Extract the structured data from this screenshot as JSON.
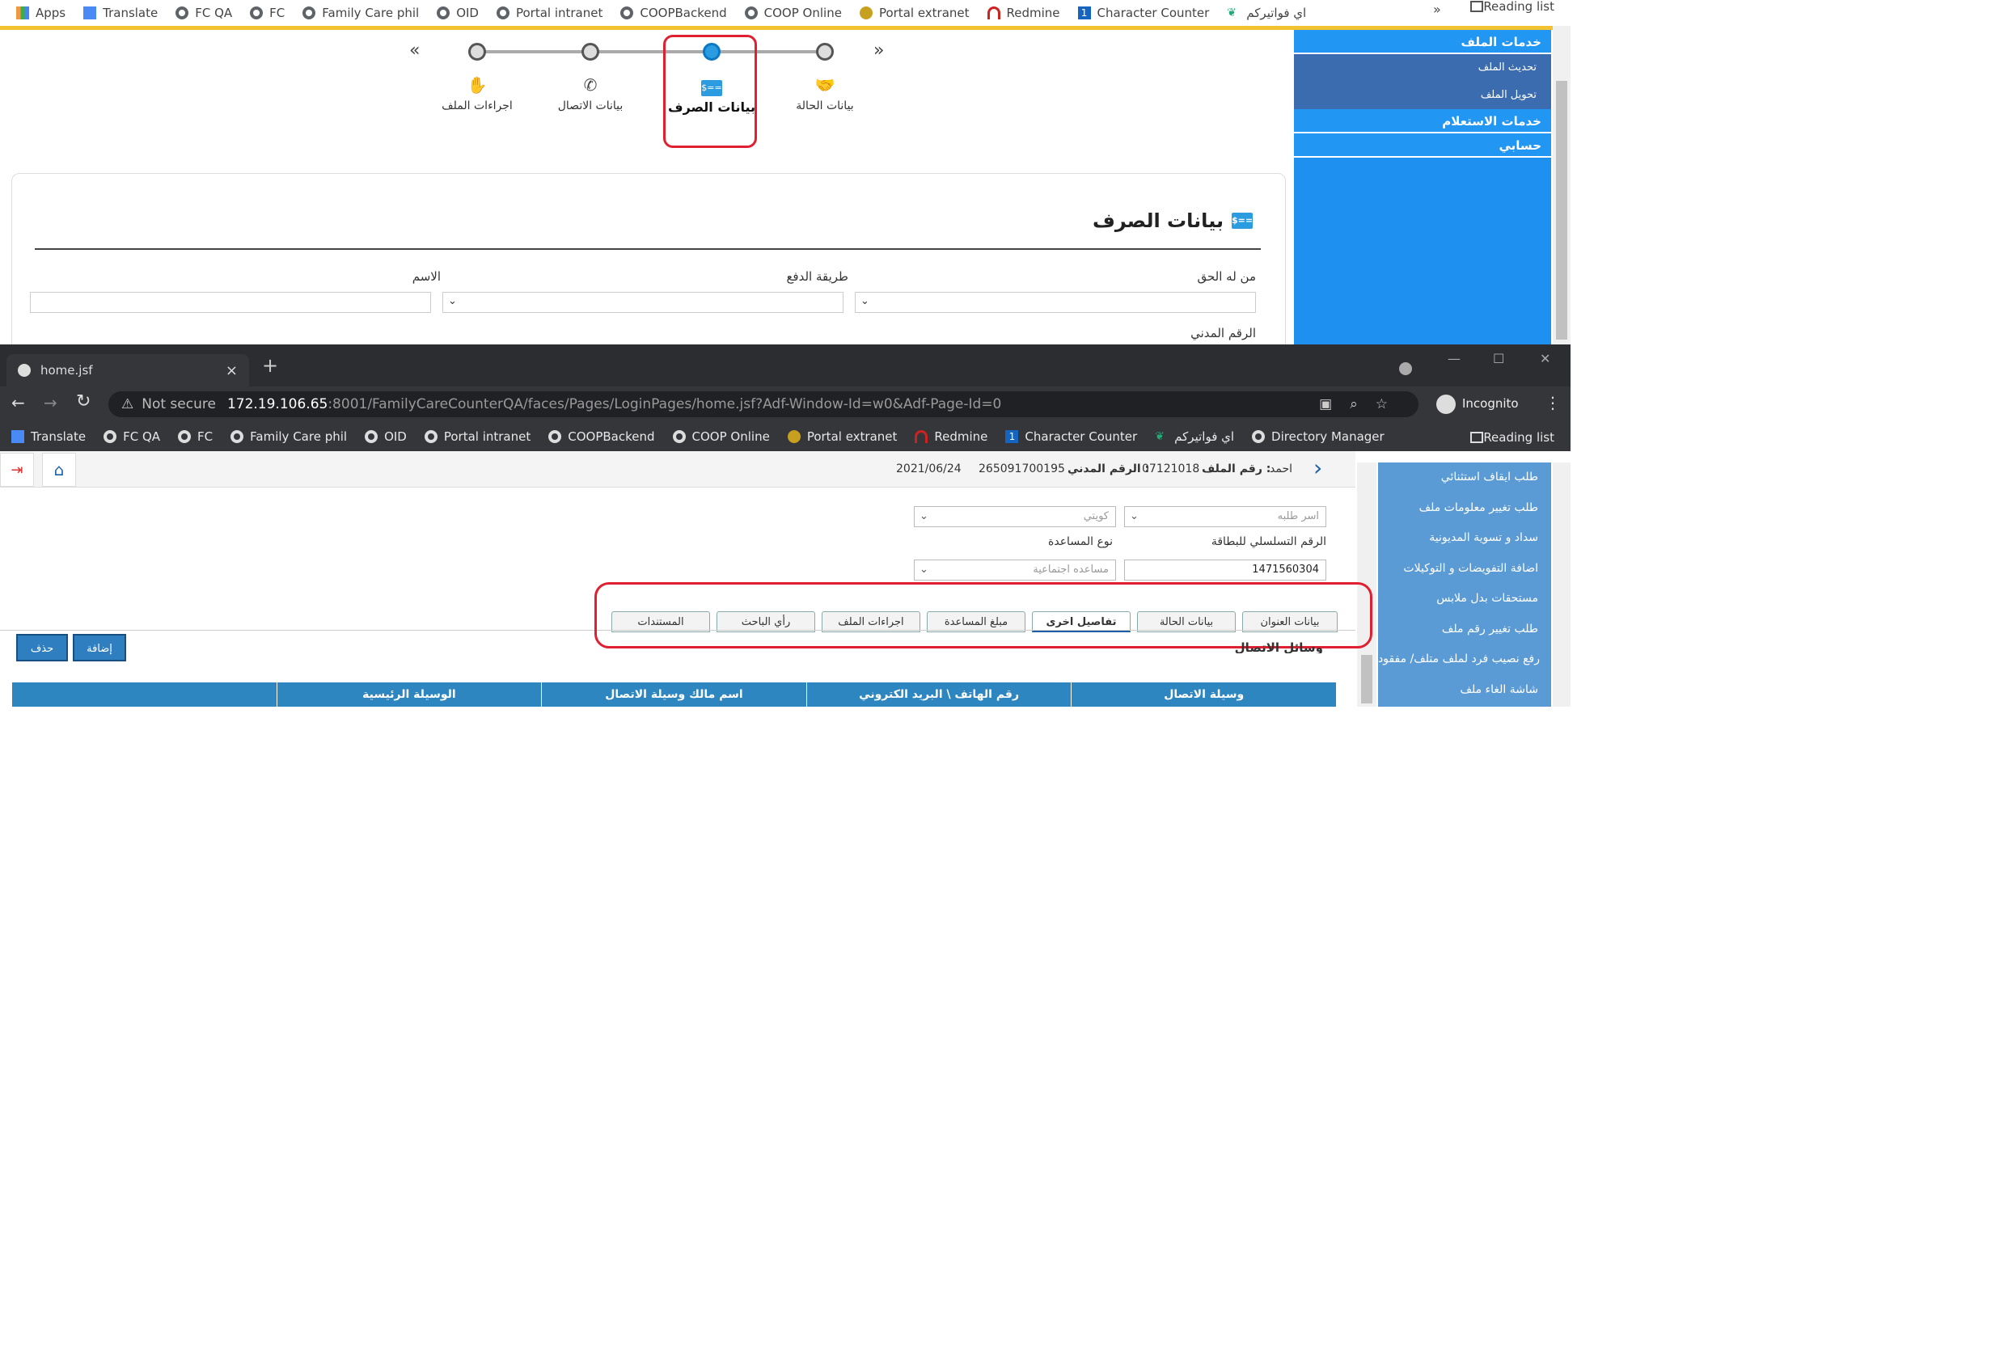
{
  "top_window": {
    "bookmarks": [
      "Apps",
      "Translate",
      "FC QA",
      "FC",
      "Family Care phil",
      "OID",
      "Portal intranet",
      "COOPBackend",
      "COOP Online",
      "Portal extranet",
      "Redmine",
      "Character Counter",
      "اي فواتيركم"
    ],
    "more": "»",
    "reading_list": "Reading list",
    "stepper": {
      "prev": "«",
      "next": "»",
      "steps": [
        {
          "label": "بيانات الحالة",
          "icon": "handshake-icon",
          "active": false
        },
        {
          "label": "بيانات الصرف",
          "icon": "payment-card-icon",
          "active": true
        },
        {
          "label": "بيانات الاتصال",
          "icon": "phone-icon",
          "active": false
        },
        {
          "label": "اجراءات الملف",
          "icon": "hand-icon",
          "active": false
        }
      ]
    },
    "form": {
      "title": "بيانات الصرف",
      "title_icon": "$==",
      "fields": [
        {
          "label": "من له الحق",
          "type": "select"
        },
        {
          "label": "طريقة الدفع",
          "type": "select"
        },
        {
          "label": "الاسم",
          "type": "text"
        }
      ],
      "next_label": "الرقم المدني"
    },
    "sidebar": {
      "sections": [
        {
          "title": "خدمات الملف",
          "items": [
            "تحديث الملف",
            "تحويل الملف"
          ]
        },
        {
          "title": "خدمات الاستعلام",
          "items": []
        },
        {
          "title": "حسابي",
          "items": []
        }
      ]
    }
  },
  "bottom_window": {
    "tab_title": "home.jsf",
    "tab_close": "×",
    "new_tab": "+",
    "window_controls": [
      "—",
      "☐",
      "✕"
    ],
    "security": "Not secure",
    "url_host": "172.19.106.65",
    "url_rest": ":8001/FamilyCareCounterQA/faces/Pages/LoginPages/home.jsf?Adf-Window-Id=w0&Adf-Page-Id=0",
    "profile": "Incognito",
    "bookmarks": [
      "Translate",
      "FC QA",
      "FC",
      "Family Care phil",
      "OID",
      "Portal intranet",
      "COOPBackend",
      "COOP Online",
      "Portal extranet",
      "Redmine",
      "Character Counter",
      "اي فواتيركم",
      "Directory Manager"
    ],
    "reading_list": "Reading list",
    "header": {
      "name": "احمد",
      "file_no_label": "رقم الملف :",
      "file_no": "07121018",
      "civil_label": "الرقم المدني :",
      "civil_no": "265091700195",
      "date": "2021/06/24"
    },
    "fields": {
      "family_name_placeholder": "اسر طلبه",
      "nationality_value": "كويتي",
      "card_serial_label": "الرقم التسلسلي للبطاقة",
      "card_serial_value": "1471560304",
      "aid_type_label": "نوع المساعدة",
      "aid_type_value": "مساعده اجتماعية"
    },
    "tabs": [
      "بيانات العنوان",
      "بيانات الحالة",
      "تفاصيل اخرى",
      "مبلغ المساعدة",
      "اجراءات الملف",
      "رأي الباحث",
      "المستندات"
    ],
    "active_tab": "تفاصيل اخرى",
    "section_title": "وسائل الاتصال",
    "buttons": {
      "add": "إضافة",
      "delete": "حذف"
    },
    "table_headers": [
      "وسيلة الاتصال",
      "رقم الهاتف \\ البريد الكتروني",
      "اسم مالك وسيلة الاتصال",
      "الوسيلة الرئيسية",
      ""
    ],
    "sidebar_items": [
      "طلب ايقاف استثنائي",
      "طلب تغيير معلومات ملف",
      "سداد و تسوية المديونية",
      "اضافة التفويضات و التوكيلات",
      "مستحقات بدل ملابس",
      "طلب تغيير رقم ملف",
      "رفع نصيب فرد لملف متلف/ مفقود",
      "شاشة الغاء ملف"
    ]
  },
  "colors": {
    "accent": "#2196f3",
    "highlight": "#e02030",
    "table_header": "#2e86c1",
    "nav_light": "#5b9bd5",
    "tab_bg": "#35363a"
  }
}
